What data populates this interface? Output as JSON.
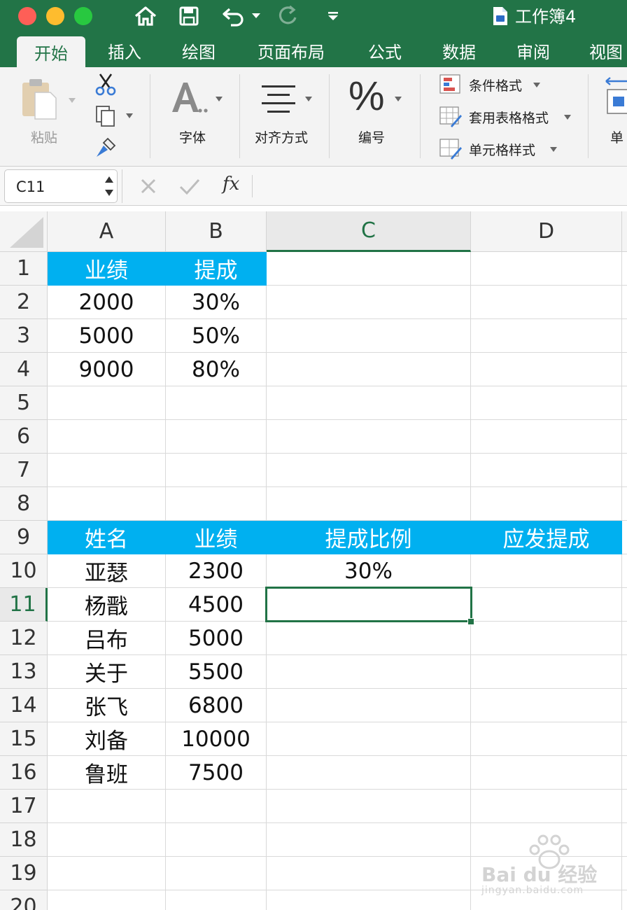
{
  "window": {
    "title": "工作簿4",
    "doc_icon": "word-doc-icon"
  },
  "quick_access": [
    "home-icon",
    "save-icon",
    "undo-icon",
    "undo-dropdown-icon",
    "redo-icon",
    "customize-icon"
  ],
  "tabs": [
    {
      "label": "开始",
      "active": true
    },
    {
      "label": "插入"
    },
    {
      "label": "绘图"
    },
    {
      "label": "页面布局"
    },
    {
      "label": "公式"
    },
    {
      "label": "数据"
    },
    {
      "label": "审阅"
    },
    {
      "label": "视图"
    }
  ],
  "ribbon": {
    "paste_label": "粘贴",
    "font_label": "字体",
    "align_label": "对齐方式",
    "number_label": "编号",
    "cond_format": "条件格式",
    "table_format": "套用表格格式",
    "cell_style": "单元格样式",
    "cell_group_partial": "单"
  },
  "formula_bar": {
    "name_box": "C11",
    "fx": "fx",
    "content": ""
  },
  "columns": [
    "A",
    "B",
    "C",
    "D"
  ],
  "selected_column": "C",
  "rows": [
    "1",
    "2",
    "3",
    "4",
    "5",
    "6",
    "7",
    "8",
    "9",
    "10",
    "11",
    "12",
    "13",
    "14",
    "15",
    "16",
    "17",
    "18",
    "19",
    "20"
  ],
  "selected_row": "11",
  "cells": {
    "table1_header": [
      "业绩",
      "提成"
    ],
    "table1": [
      [
        "2000",
        "30%"
      ],
      [
        "5000",
        "50%"
      ],
      [
        "9000",
        "80%"
      ]
    ],
    "table2_header": [
      "姓名",
      "业绩",
      "提成比例",
      "应发提成"
    ],
    "table2": [
      [
        "亚瑟",
        "2300",
        "30%",
        ""
      ],
      [
        "杨戬",
        "4500",
        "",
        ""
      ],
      [
        "吕布",
        "5000",
        "",
        ""
      ],
      [
        "关于",
        "5500",
        "",
        ""
      ],
      [
        "张飞",
        "6800",
        "",
        ""
      ],
      [
        "刘备",
        "10000",
        "",
        ""
      ],
      [
        "鲁班",
        "7500",
        "",
        ""
      ]
    ]
  },
  "header_fill_color": "#00b0f0",
  "accent_color": "#217346",
  "watermark": {
    "brand": "Bai du 经验",
    "url": "jingyan.baidu.com"
  }
}
